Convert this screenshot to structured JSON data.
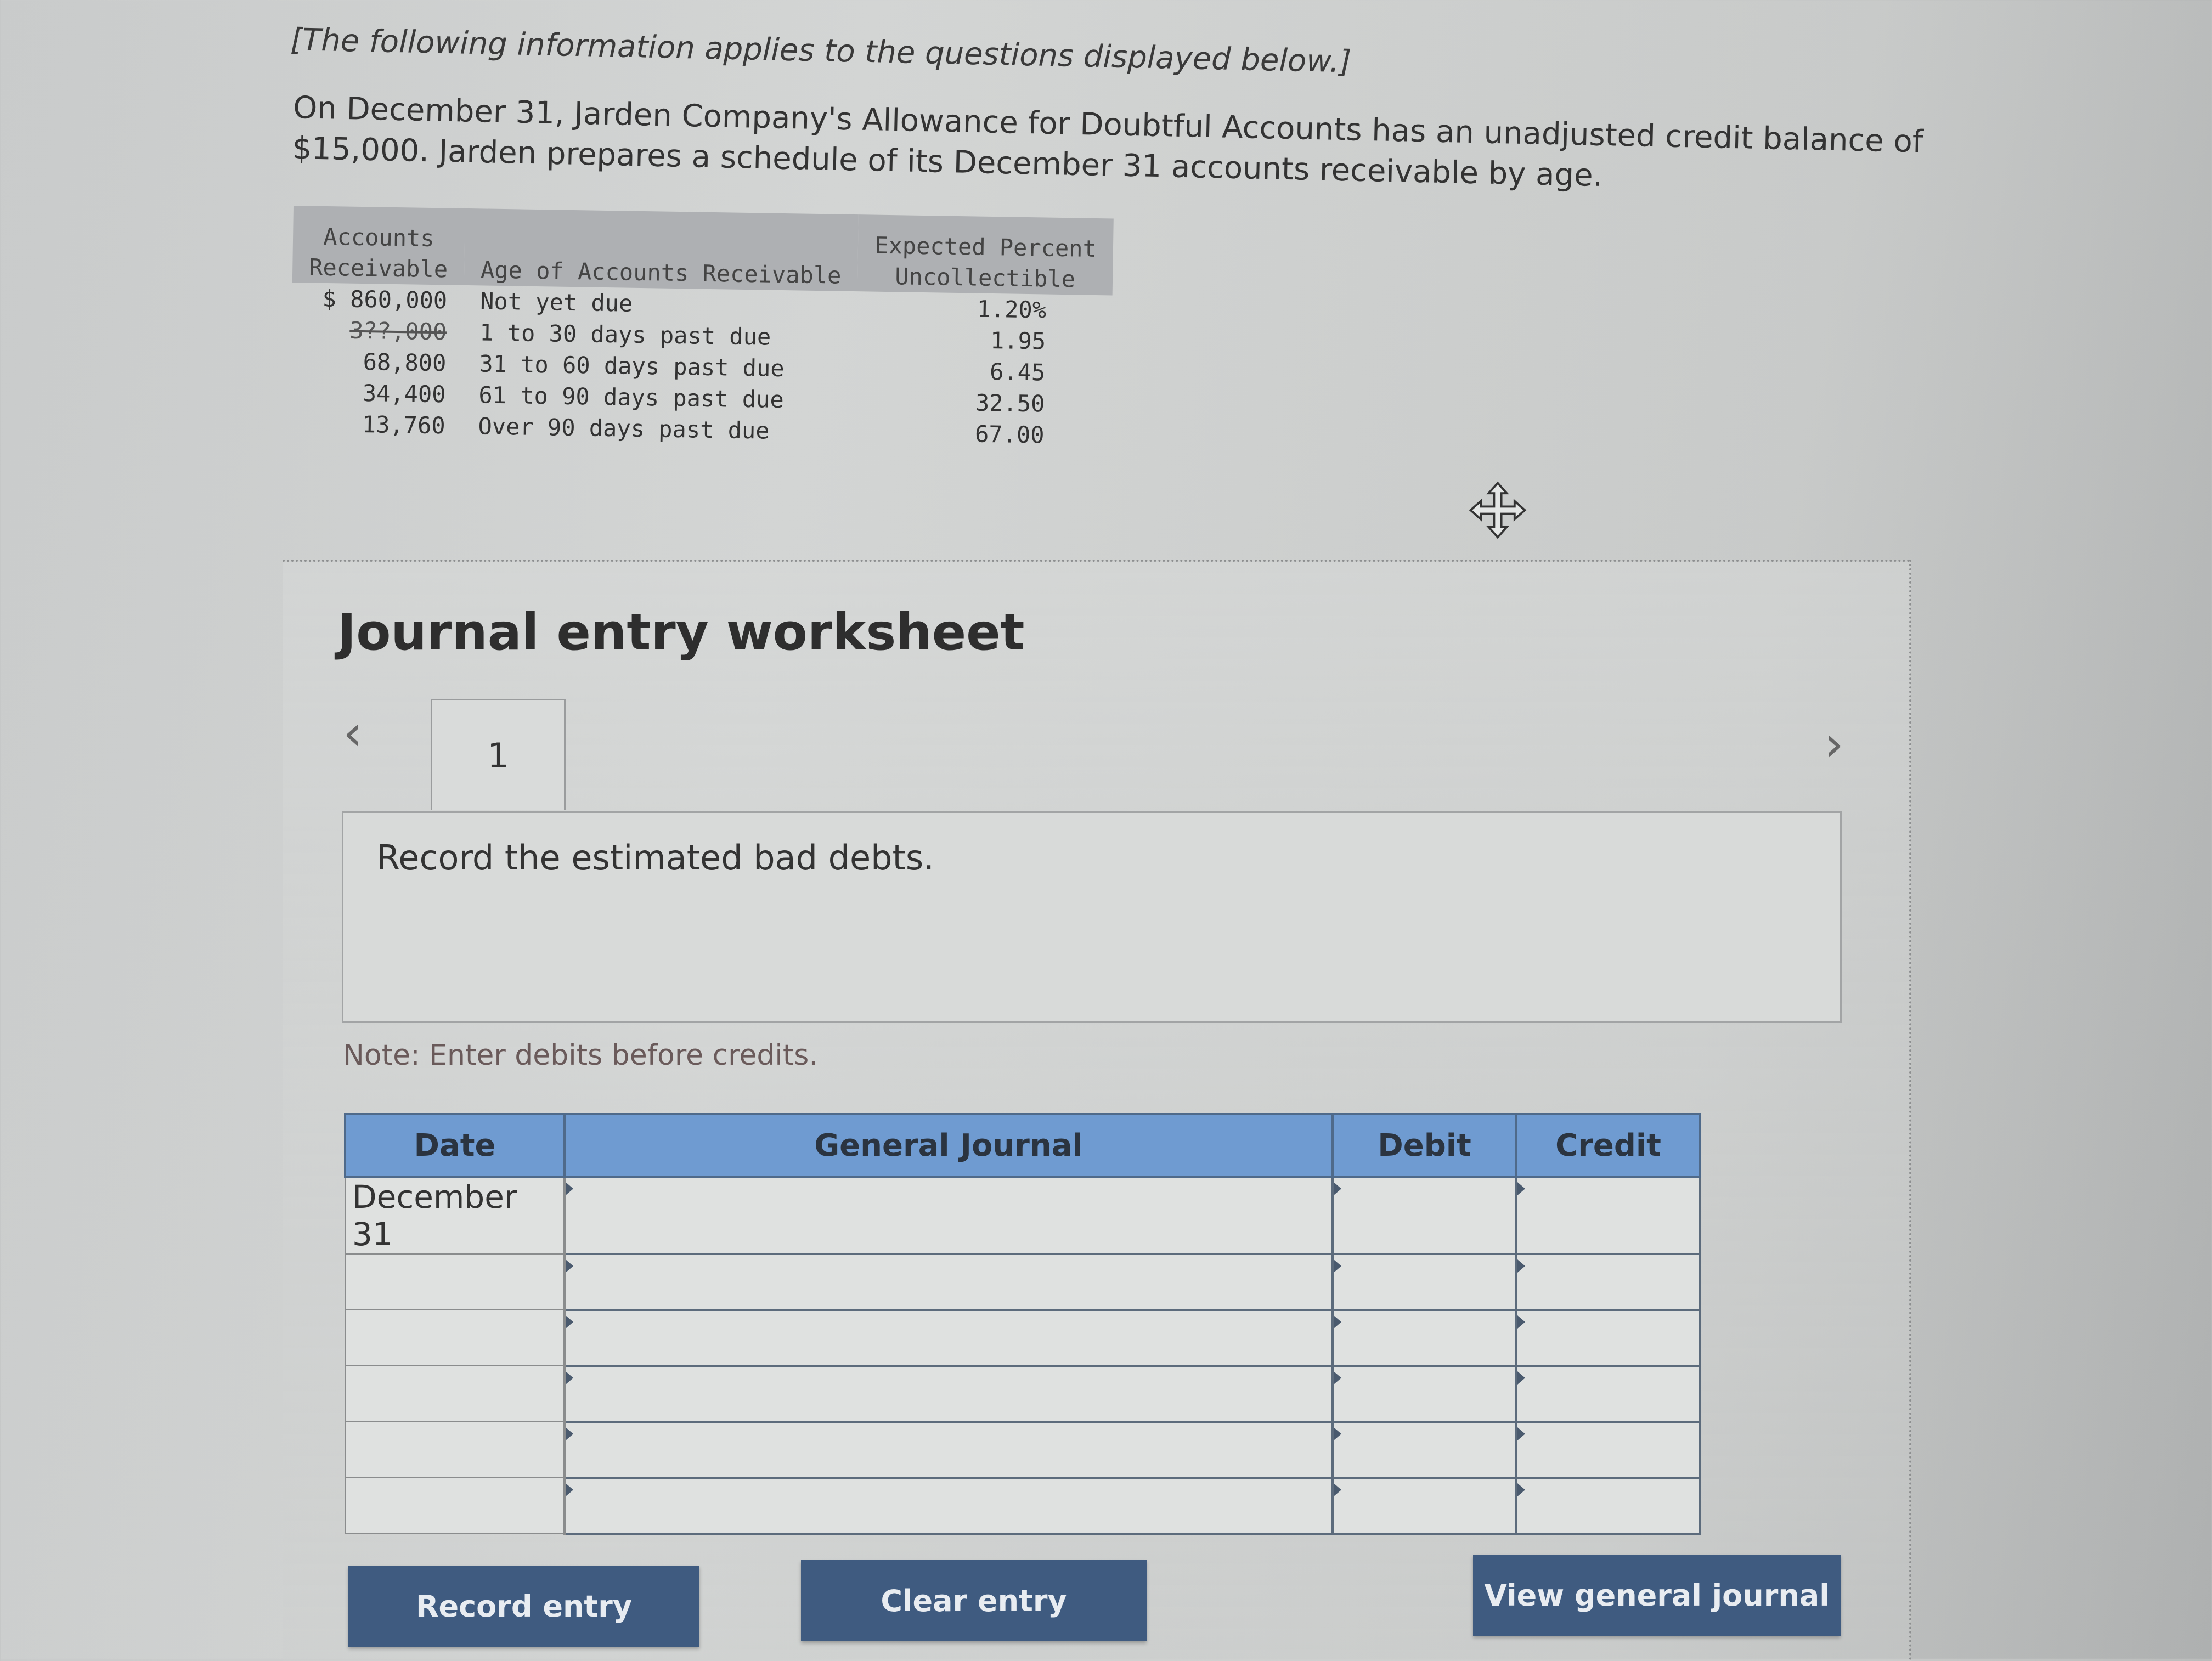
{
  "intro": {
    "note": "[The following information applies to the questions displayed below.]",
    "paragraph": "On December 31, Jarden Company's Allowance for Doubtful Accounts has an unadjusted credit balance of $15,000. Jarden prepares a schedule of its December 31 accounts receivable by age."
  },
  "aging_schedule": {
    "headers": {
      "receivable_line1": "Accounts",
      "receivable_line2": "Receivable",
      "age": "Age of Accounts Receivable",
      "pct_line1": "Expected Percent",
      "pct_line2": "Uncollectible"
    },
    "rows": [
      {
        "amount": "$ 860,000",
        "age": "Not yet due",
        "percent": "1.20%"
      },
      {
        "amount": "3?0,000 (obscured by screen crack)",
        "age": "1 to 30 days past due",
        "percent": "1.95"
      },
      {
        "amount": "68,800",
        "age": "31 to 60 days past due",
        "percent": "6.45"
      },
      {
        "amount": "34,400",
        "age": "61 to 90 days past due",
        "percent": "32.50"
      },
      {
        "amount": "13,760",
        "age": "Over 90 days past due",
        "percent": "67.00"
      }
    ]
  },
  "worksheet": {
    "title": "Journal entry worksheet",
    "prev_icon": "chevron-left-icon",
    "next_icon": "chevron-right-icon",
    "active_tab": "1",
    "instruction": "Record the estimated bad debts.",
    "note": "Note: Enter debits before credits.",
    "journal": {
      "columns": [
        "Date",
        "General Journal",
        "Debit",
        "Credit"
      ],
      "rows": [
        {
          "date": "December 31",
          "account": "",
          "debit": "",
          "credit": ""
        },
        {
          "date": "",
          "account": "",
          "debit": "",
          "credit": ""
        },
        {
          "date": "",
          "account": "",
          "debit": "",
          "credit": ""
        },
        {
          "date": "",
          "account": "",
          "debit": "",
          "credit": ""
        },
        {
          "date": "",
          "account": "",
          "debit": "",
          "credit": ""
        },
        {
          "date": "",
          "account": "",
          "debit": "",
          "credit": ""
        }
      ]
    },
    "buttons": {
      "record": "Record entry",
      "clear": "Clear entry",
      "view": "View general journal"
    }
  },
  "colors": {
    "header_blue": "#6f9bd1",
    "button_navy": "#3f5b80"
  }
}
